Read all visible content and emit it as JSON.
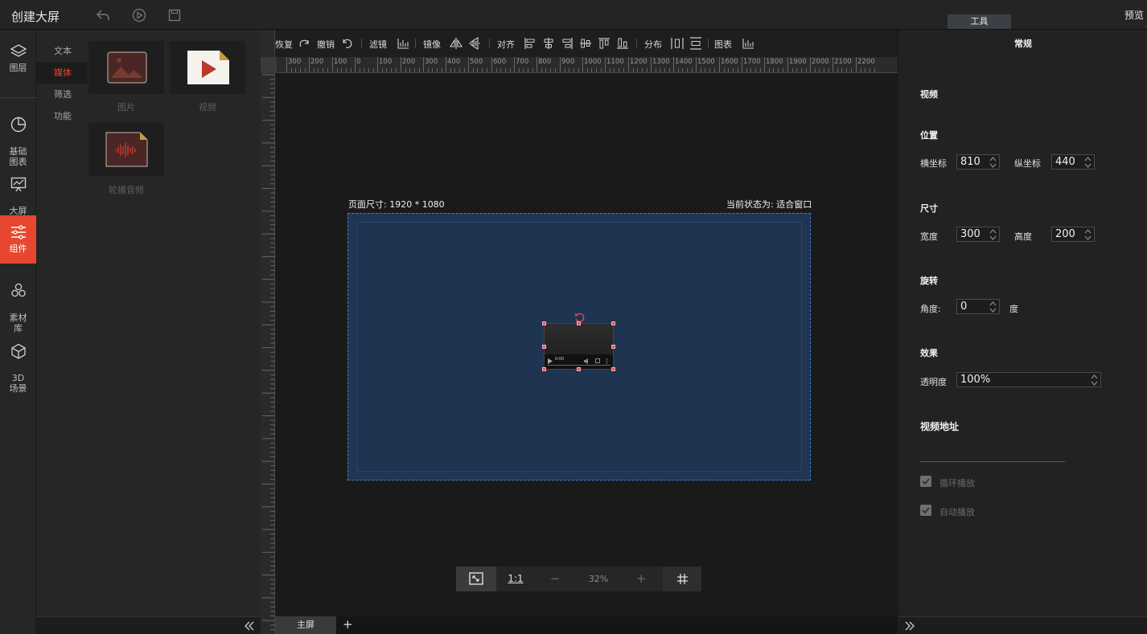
{
  "app": {
    "title": "创建大屏",
    "tool_tab": "工具",
    "preview": "预览"
  },
  "leftnav": {
    "items": [
      {
        "label": "图层",
        "icon": "layers-icon"
      },
      {
        "label": "基础\n图表",
        "icon": "pie-chart-icon"
      },
      {
        "label": "大屏\n图表",
        "icon": "monitor-chart-icon"
      },
      {
        "label": "组件",
        "icon": "sliders-icon",
        "active": true
      },
      {
        "label": "素材\n库",
        "icon": "hexagons-icon"
      },
      {
        "label": "3D\n场景",
        "icon": "cube-icon"
      }
    ]
  },
  "subpanel": {
    "tabs": [
      "文本",
      "媒体",
      "筛选",
      "功能"
    ],
    "active_tab": "媒体",
    "assets": [
      {
        "label": "图片",
        "icon": "image-icon"
      },
      {
        "label": "视频",
        "icon": "video-icon"
      },
      {
        "label": "轮播音频",
        "icon": "audio-icon"
      }
    ]
  },
  "toolbar": {
    "redo": "恢复",
    "undo": "撤销",
    "filter": "滤镜",
    "mirror": "镜像",
    "align": "对齐",
    "distribute": "分布",
    "chart": "图表"
  },
  "ruler": {
    "labels": [
      "300",
      "200",
      "100",
      "0",
      "100",
      "200",
      "300",
      "400",
      "500",
      "600",
      "700",
      "800",
      "900",
      "1000",
      "1100",
      "1200",
      "1300",
      "1400",
      "1500",
      "1600",
      "1700",
      "1800",
      "1900",
      "2000",
      "2100",
      "2200"
    ]
  },
  "canvas": {
    "page_size": "页面尺寸: 1920 * 1080",
    "state": "当前状态为: 适合窗口",
    "video_time": "0:00"
  },
  "zoom": {
    "one_to_one": "1:1",
    "minus": "−",
    "level": "32%",
    "plus": "+"
  },
  "pages": {
    "main": "主屏",
    "add": "+"
  },
  "properties": {
    "tab": "常规",
    "video_heading": "视频",
    "position_heading": "位置",
    "x_label": "横坐标",
    "x_value": "810",
    "y_label": "纵坐标",
    "y_value": "440",
    "size_heading": "尺寸",
    "width_label": "宽度",
    "width_value": "300",
    "height_label": "高度",
    "height_value": "200",
    "rotate_heading": "旋转",
    "angle_label": "角度:",
    "angle_value": "0",
    "angle_unit": "度",
    "effect_heading": "效果",
    "opacity_label": "透明度",
    "opacity_value": "100%",
    "url_heading": "视频地址",
    "loop_label": "循环播放",
    "autoplay_label": "自动播放"
  },
  "colors": {
    "accent": "#e8472f",
    "page_bg": "#1f3552",
    "handle": "#f04a5a"
  }
}
